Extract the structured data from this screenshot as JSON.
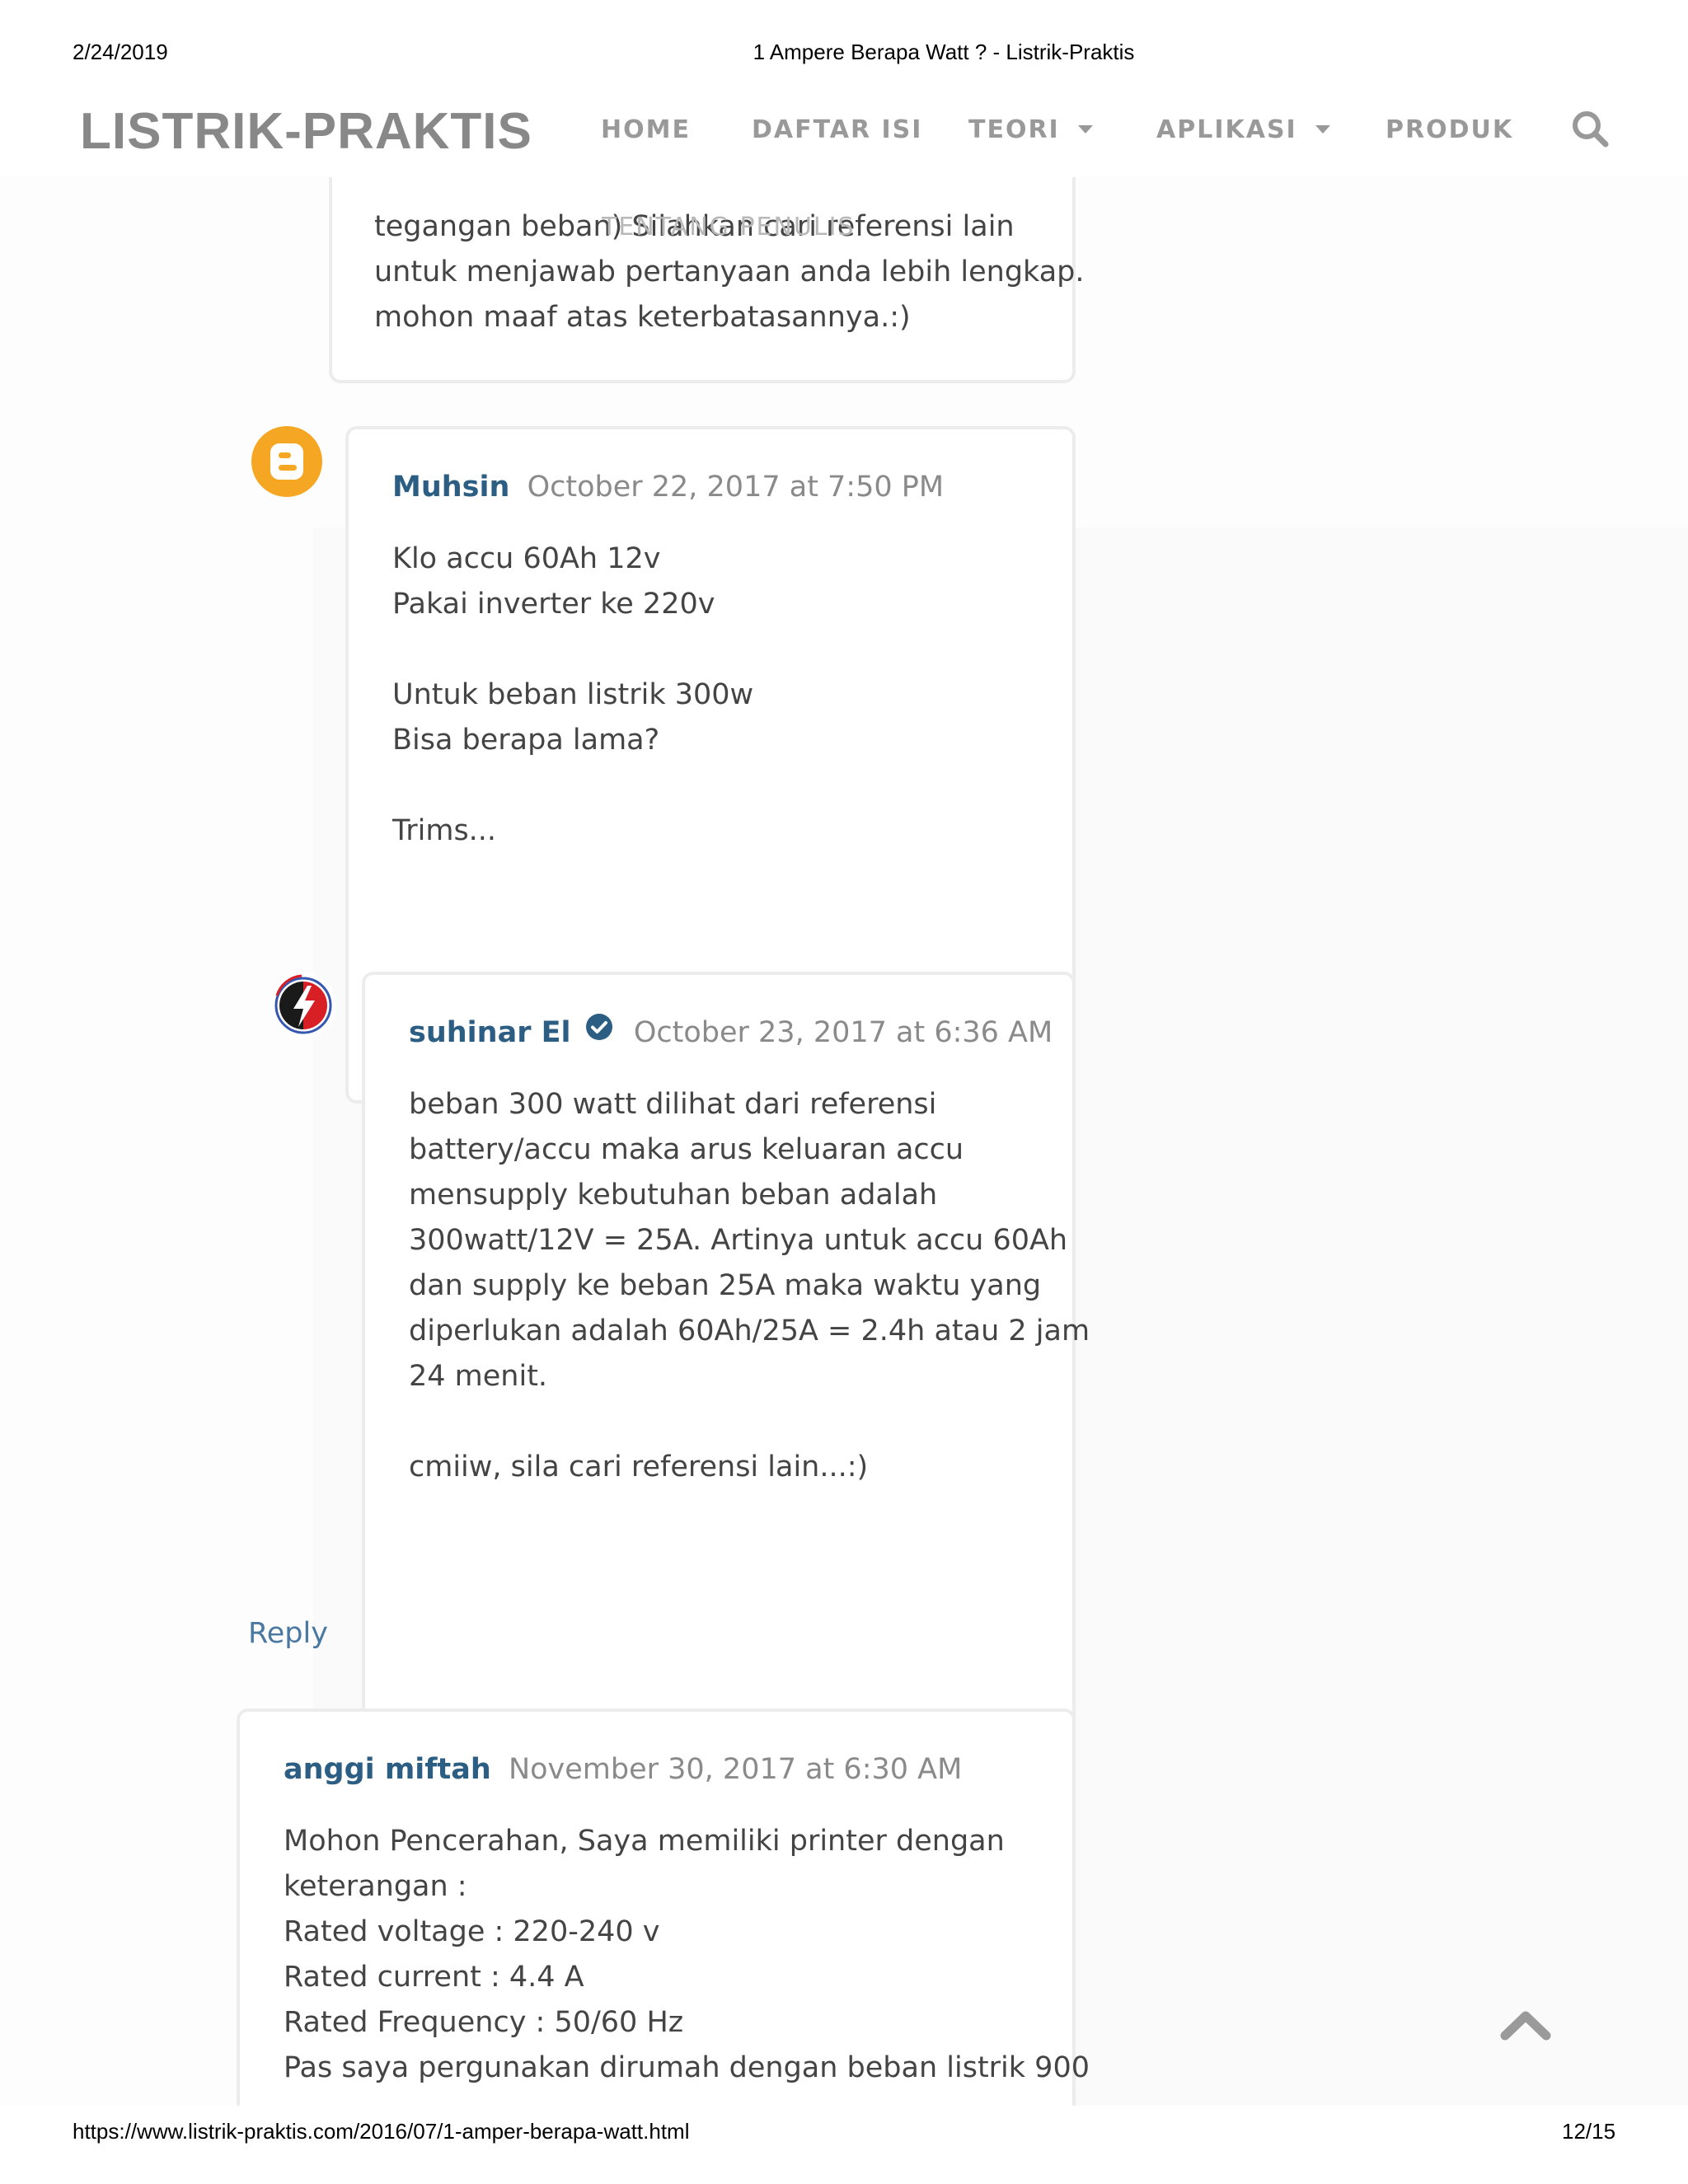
{
  "print_header": {
    "date": "2/24/2019",
    "title": "1 Ampere Berapa Watt ? - Listrik-Praktis"
  },
  "print_footer": {
    "url": "https://www.listrik-praktis.com/2016/07/1-amper-berapa-watt.html",
    "page": "12/15"
  },
  "site": {
    "logo": "LISTRIK-PRAKTIS",
    "nav": [
      "HOME",
      "DAFTAR ISI",
      "TEORI",
      "APLIKASI",
      "PRODUK"
    ],
    "search_icon": "search-icon",
    "overlap_menu_text": "TENTANG PENULIS"
  },
  "comments": {
    "prev_reply_tail": [
      "tegangan beban) Silahkan cari referensi lain",
      "untuk menjawab pertanyaan anda lebih lengkap.",
      "mohon maaf atas keterbatasannya.:)"
    ],
    "muhsin": {
      "author": "Muhsin",
      "date": "October 22, 2017 at 7:50 PM",
      "avatar_icon": "blogger-icon",
      "lines": [
        "Klo accu 60Ah 12v",
        "Pakai inverter ke 220v",
        "Untuk beban listrik 300w",
        "Bisa berapa lama?",
        "Trims..."
      ]
    },
    "suhinar": {
      "author": "suhinar El",
      "verified_icon": "verified-check-icon",
      "date": "October 23, 2017 at 6:36 AM",
      "avatar_icon": "listrik-praktis-logo",
      "lines": [
        "beban 300 watt dilihat dari referensi",
        "battery/accu maka arus keluaran accu",
        "mensupply kebutuhan beban adalah",
        "300watt/12V = 25A. Artinya untuk accu 60Ah",
        "dan supply ke beban 25A maka waktu yang",
        "diperlukan adalah 60Ah/25A = 2.4h atau 2 jam",
        "24 menit.",
        "cmiiw, sila cari referensi lain...:)"
      ]
    },
    "reply_label": "Reply",
    "anggi": {
      "author": "anggi miftah",
      "date": "November 30, 2017 at 6:30 AM",
      "lines": [
        "Mohon Pencerahan, Saya memiliki printer dengan",
        "keterangan :",
        "Rated voltage : 220-240 v",
        "Rated current : 4.4 A",
        "Rated Frequency : 50/60 Hz",
        "Pas saya pergunakan dirumah dengan beban listrik 900"
      ]
    }
  },
  "colors": {
    "author": "#2c5e83",
    "date": "#8a8a8a",
    "text": "#444444",
    "nav": "#999999",
    "logo": "#888888",
    "blogger_orange": "#f5a623",
    "verified_blue": "#2c5e83"
  },
  "scroll_top_icon": "chevron-up-icon"
}
